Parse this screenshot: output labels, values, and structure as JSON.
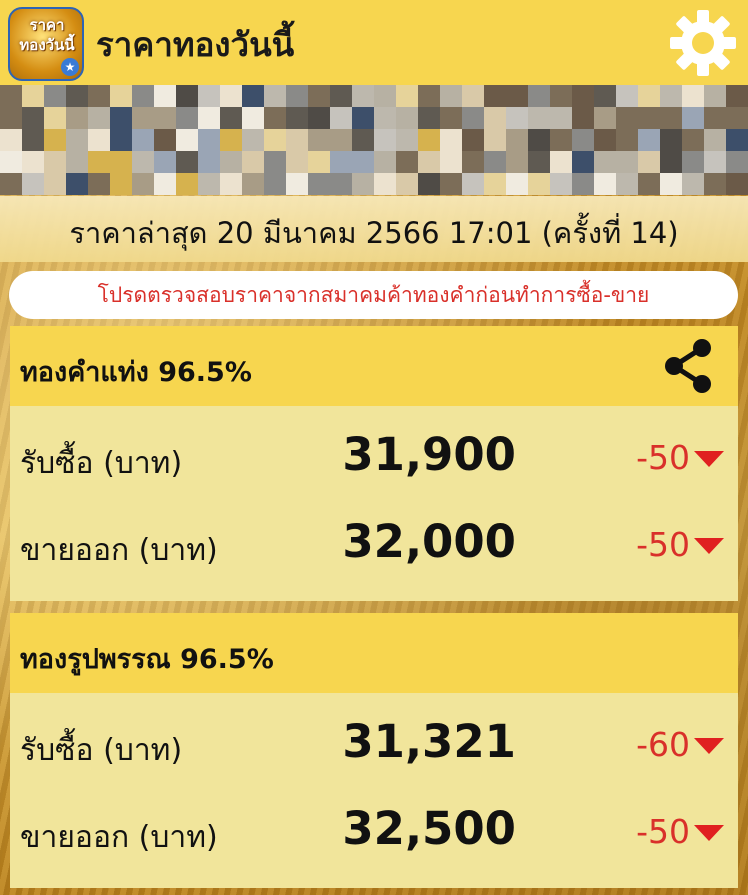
{
  "app": {
    "title": "ราคาทองวันนี้",
    "logo_line1": "ราคา",
    "logo_line2": "ทองวันนี้"
  },
  "icons": {
    "settings": "gear-icon",
    "share": "share-icon",
    "change": "triangle-down-icon"
  },
  "colors": {
    "header": "#f7d64f",
    "card_body": "#f1e59b",
    "negative": "#d9302a"
  },
  "update": {
    "text": "ราคาล่าสุด 20 มีนาคม 2566  17:01  (ครั้งที่ 14)"
  },
  "notice": "โปรดตรวจสอบราคาจากสมาคมค้าทองคำก่อนทำการซื้อ-ขาย",
  "cards": [
    {
      "title": "ทองคำแท่ง 96.5%",
      "rows": [
        {
          "label": "รับซื้อ (บาท)",
          "price": "31,900",
          "change": "-50"
        },
        {
          "label": "ขายออก (บาท)",
          "price": "32,000",
          "change": "-50"
        }
      ]
    },
    {
      "title": "ทองรูปพรรณ 96.5%",
      "rows": [
        {
          "label": "รับซื้อ (บาท)",
          "price": "31,321",
          "change": "-60"
        },
        {
          "label": "ขายออก (บาท)",
          "price": "32,500",
          "change": "-50"
        }
      ]
    }
  ]
}
